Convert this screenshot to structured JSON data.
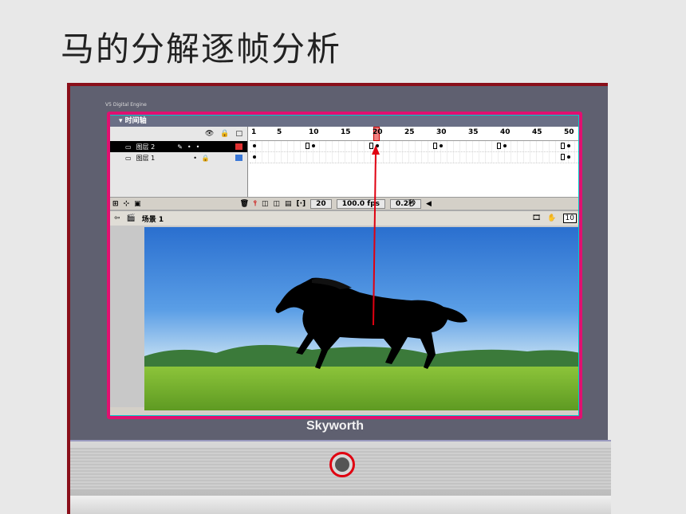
{
  "slide": {
    "title": "马的分解逐帧分析"
  },
  "tv": {
    "brand": "Skyworth",
    "small_label": "V5 Digital Engine"
  },
  "timeline": {
    "panel_title": "时间轴",
    "ruler_marks": [
      "1",
      "5",
      "10",
      "15",
      "20",
      "25",
      "30",
      "35",
      "40",
      "45",
      "50"
    ],
    "layers": [
      {
        "name": "图层 2",
        "color": "#e03030",
        "selected": true
      },
      {
        "name": "图层 1",
        "color": "#3a78d8",
        "selected": false
      }
    ],
    "current_frame": "20",
    "fps": "100.0 fps",
    "time": "0.2秒"
  },
  "scene": {
    "label": "场景 1",
    "zoom": "10"
  }
}
